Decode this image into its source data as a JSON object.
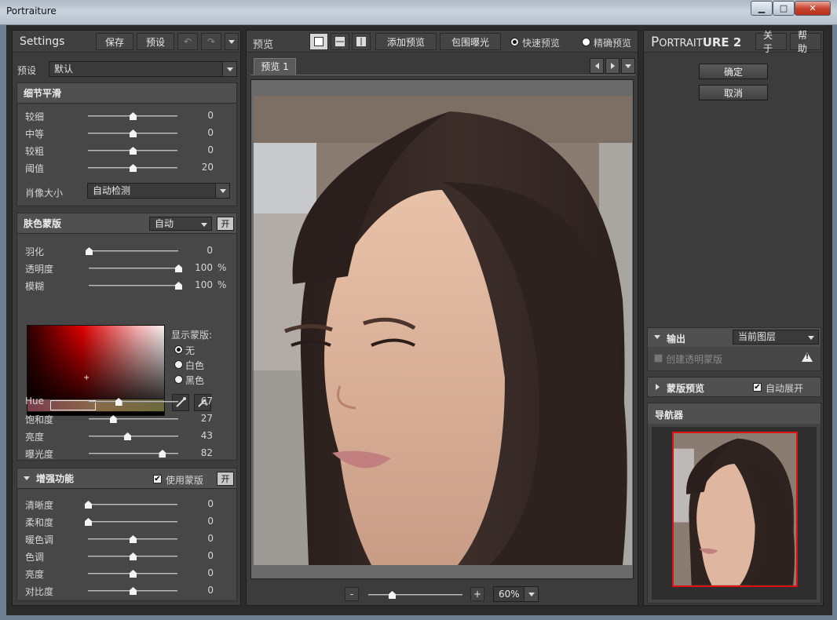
{
  "window": {
    "title": "Portraiture",
    "minimize_glyph": "▁",
    "maximize_glyph": "□",
    "close_glyph": "✕"
  },
  "left": {
    "header": {
      "title": "Settings",
      "save": "保存",
      "preset": "预设",
      "undo_glyph": "↶",
      "redo_glyph": "↷"
    },
    "preset_row": {
      "label": "预设",
      "value": "默认"
    },
    "detail": {
      "title": "细节平滑",
      "sliders": [
        {
          "label": "较细",
          "value": "0",
          "level": 0.5
        },
        {
          "label": "中等",
          "value": "0",
          "level": 0.5
        },
        {
          "label": "较粗",
          "value": "0",
          "level": 0.5
        },
        {
          "label": "阈值",
          "value": "20",
          "level": 0.5
        }
      ],
      "portrait_size_label": "肖像大小",
      "portrait_size_value": "自动检测"
    },
    "skin": {
      "title": "肤色蒙版",
      "mode": "自动",
      "on": "开",
      "sliders": [
        {
          "label": "羽化",
          "value": "0",
          "level": 0.0,
          "unit": ""
        },
        {
          "label": "透明度",
          "value": "100",
          "level": 1.0,
          "unit": "%"
        },
        {
          "label": "模糊",
          "value": "100",
          "level": 1.0,
          "unit": "%"
        }
      ],
      "show_mask_label": "显示蒙版:",
      "options": [
        "无",
        "白色",
        "黑色"
      ],
      "selected_option": 0,
      "hsl": [
        {
          "label": "Hue",
          "value": "67",
          "level": 0.33
        },
        {
          "label": "饱和度",
          "value": "27",
          "level": 0.27
        },
        {
          "label": "亮度",
          "value": "43",
          "level": 0.43
        },
        {
          "label": "曝光度",
          "value": "82",
          "level": 0.82
        }
      ]
    },
    "enhance": {
      "title": "增强功能",
      "use_mask": "使用蒙版",
      "on": "开",
      "sliders": [
        {
          "label": "清晰度",
          "value": "0",
          "level": 0.0
        },
        {
          "label": "柔和度",
          "value": "0",
          "level": 0.0
        },
        {
          "label": "暖色调",
          "value": "0",
          "level": 0.5
        },
        {
          "label": "色调",
          "value": "0",
          "level": 0.5
        },
        {
          "label": "亮度",
          "value": "0",
          "level": 0.5
        },
        {
          "label": "对比度",
          "value": "0",
          "level": 0.5
        }
      ]
    }
  },
  "center": {
    "header": {
      "title": "预览",
      "add_preview": "添加预览",
      "clip_exposure": "包围曝光",
      "fast_preview": "快速预览",
      "accurate_preview": "精确预览"
    },
    "tab": "预览 1",
    "zoom": {
      "minus": "-",
      "plus": "+",
      "value": "60%",
      "level": 0.25
    }
  },
  "right": {
    "brand_first": "P",
    "brand_small": "ORTRAIT",
    "brand_bold": "URE 2",
    "about": "关于",
    "help": "帮助",
    "ok": "确定",
    "cancel": "取消",
    "output": {
      "title": "输出",
      "value": "当前图层",
      "create_mask": "创建透明蒙版",
      "warning_glyph": "!"
    },
    "mask_preview": {
      "title": "蒙版预览",
      "auto_expand": "自动展开"
    },
    "navigator": {
      "title": "导航器"
    }
  },
  "colors": {
    "nav_frame": "#e01010",
    "panel": "#3c3c3c"
  }
}
